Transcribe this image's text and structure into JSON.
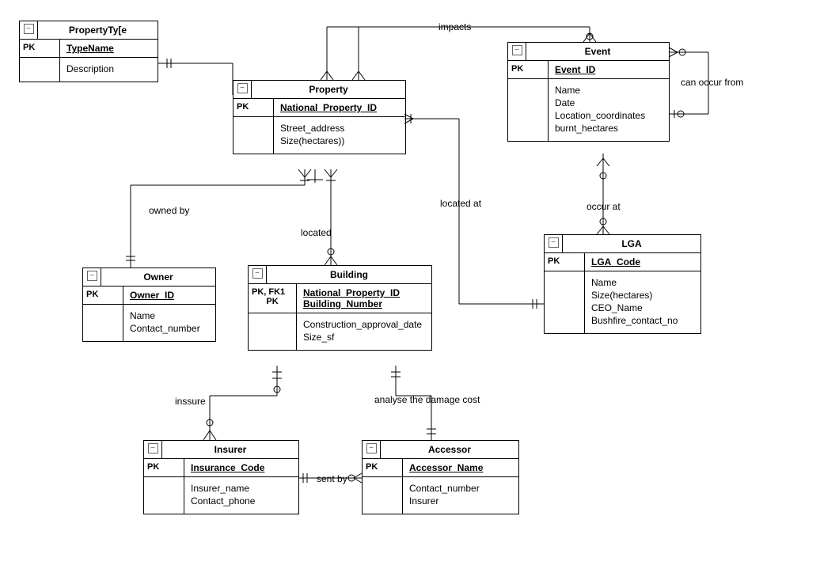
{
  "entities": {
    "propertyType": {
      "title": "PropertyTy[e",
      "pk_label": "PK",
      "pk": "TypeName",
      "attrs": [
        "Description"
      ]
    },
    "property": {
      "title": "Property",
      "pk_label": "PK",
      "pk": "National_Property_ID",
      "attrs": [
        "Street_address",
        "Size(hectares))"
      ]
    },
    "event": {
      "title": "Event",
      "pk_label": "PK",
      "pk": "Event_ID",
      "attrs": [
        "Name",
        "Date",
        "Location_coordinates",
        "burnt_hectares"
      ]
    },
    "owner": {
      "title": "Owner",
      "pk_label": "PK",
      "pk": "Owner_ID",
      "attrs": [
        "Name",
        "Contact_number"
      ]
    },
    "building": {
      "title": "Building",
      "pk_label1": "PK, FK1",
      "pk_label2": "PK",
      "pk1": "National_Property_ID",
      "pk2": "Building_Number",
      "attrs": [
        "Construction_approval_date",
        "Size_sf"
      ]
    },
    "lga": {
      "title": "LGA",
      "pk_label": "PK",
      "pk": "LGA_Code",
      "attrs": [
        "Name",
        "Size(hectares)",
        "CEO_Name",
        "Bushfire_contact_no"
      ]
    },
    "insurer": {
      "title": "Insurer",
      "pk_label": "PK",
      "pk": "Insurance_Code",
      "attrs": [
        "Insurer_name",
        "Contact_phone"
      ]
    },
    "accessor": {
      "title": "Accessor",
      "pk_label": "PK",
      "pk": "Accessor_Name",
      "attrs": [
        "Contact_number",
        "Insurer"
      ]
    }
  },
  "relationships": {
    "impacts": "impacts",
    "can_occur_from": "can occur from",
    "owned_by": "owned by",
    "located": "located",
    "located_at": "located at",
    "occur_at": "occur at",
    "inssure": "inssure",
    "analyse": "analyse the damage cost",
    "sent_by": "sent by"
  }
}
